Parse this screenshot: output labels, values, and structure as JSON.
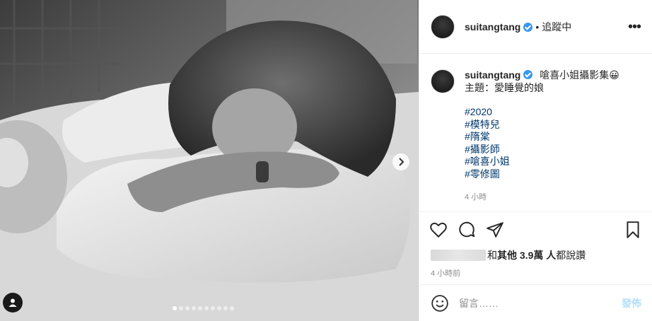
{
  "post": {
    "username": "suitangtang",
    "follow_separator": "•",
    "follow_label": "追蹤中",
    "more_label": "•••"
  },
  "caption": {
    "username": "suitangtang",
    "title": "嗆喜小姐攝影集😀",
    "subject": "主題：愛睡覺的娘",
    "hashtags": [
      "#2020",
      "#模特兒",
      "#隋棠",
      "#攝影師",
      "#嗆喜小姐",
      "#零修圖"
    ],
    "time": "4 小時"
  },
  "likes": {
    "prefix": "和 ",
    "others": "其他 3.9萬 人",
    "suffix": " 都說讚"
  },
  "post_time": "4 小時前",
  "comment": {
    "placeholder": "留言……",
    "submit_label": "發佈"
  },
  "carousel": {
    "slide_count": 10,
    "current_index": 0
  },
  "icons": {
    "next": "chevron-right-icon",
    "tagged_user": "user-tag-icon",
    "verified": "verified-badge-icon",
    "like": "heart-icon",
    "comment": "comment-icon",
    "share": "paper-plane-icon",
    "save": "bookmark-icon",
    "emoji": "smiley-icon"
  },
  "colors": {
    "verified": "#3897f0",
    "hashtag": "#00376b",
    "post_disabled": "#b2dffc"
  }
}
